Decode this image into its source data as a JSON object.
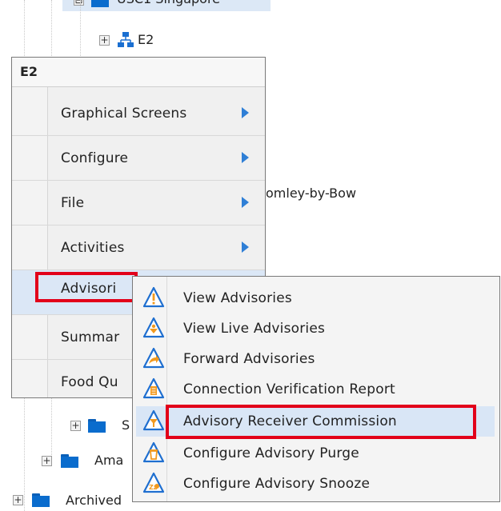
{
  "tree": {
    "top_region_label": "USC1 Singapore",
    "e2_node_label": "E2",
    "bromley_label": "omley-by-Bow",
    "s_folder_label": "S",
    "ama_folder_label": "Ama",
    "archived_label": "Archived"
  },
  "context_menu": {
    "header": "E2",
    "items": [
      {
        "label": "Graphical Screens",
        "has_submenu": true
      },
      {
        "label": "Configure",
        "has_submenu": true
      },
      {
        "label": "File",
        "has_submenu": true
      },
      {
        "label": "Activities",
        "has_submenu": true
      },
      {
        "label": "Advisori",
        "has_submenu": true,
        "active": true
      },
      {
        "label": "Summar",
        "has_submenu": false
      },
      {
        "label": "Food Qu",
        "has_submenu": false
      }
    ]
  },
  "submenu": {
    "items": [
      {
        "label": "View Advisories",
        "icon": "warning-advisory-icon"
      },
      {
        "label": "View Live Advisories",
        "icon": "live-advisory-icon"
      },
      {
        "label": "Forward Advisories",
        "icon": "forward-advisory-icon"
      },
      {
        "label": "Connection Verification Report",
        "icon": "report-advisory-icon"
      },
      {
        "label": "Advisory Receiver Commission",
        "icon": "receiver-advisory-icon",
        "active": true
      },
      {
        "label": "Configure Advisory Purge",
        "icon": "purge-advisory-icon"
      },
      {
        "label": "Configure Advisory Snooze",
        "icon": "snooze-advisory-icon"
      }
    ]
  },
  "colors": {
    "highlight_red": "#e2001a",
    "arrow_blue": "#2f7fd6",
    "folder_blue": "#0a6ccd",
    "hover_bg": "#dbe7f6"
  }
}
